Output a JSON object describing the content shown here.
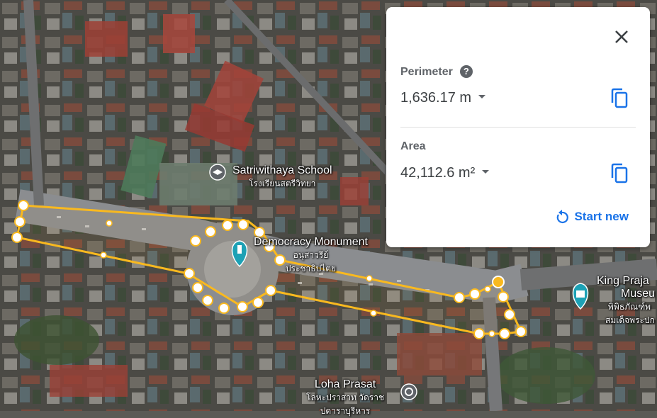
{
  "map": {
    "labels": [
      {
        "main": "Satriwithaya School",
        "sub": "โรงเรียนสตรีวิทยา"
      },
      {
        "main": "Democracy Monument",
        "sub1": "อนุสาวรีย์",
        "sub2": "ประชาธิปไตย"
      },
      {
        "main": "King Praja",
        "main2": "Museu",
        "sub1": "พิพิธภัณฑ์พ",
        "sub2": "สมเด็จพระปก"
      },
      {
        "main": "Loha Prasat",
        "sub1": "โลหะปราสาท วัดราช",
        "sub2": "ปดาราบุรีหาร"
      }
    ],
    "icons": [
      "school-pin-icon",
      "monument-pin-icon",
      "museum-pin-icon",
      "temple-pin-icon"
    ],
    "colors": {
      "measure_line": "#f9b91f",
      "pin": "#1da1b5"
    }
  },
  "panel": {
    "perimeter_label": "Perimeter",
    "help_glyph": "?",
    "perimeter_value": "1,636.17 m",
    "area_label": "Area",
    "area_value": "42,112.6 m²",
    "start_new_label": "Start new",
    "icons": [
      "close-icon",
      "help-icon",
      "copy-icon",
      "dropdown-caret-icon",
      "restart-icon"
    ],
    "accent_color": "#1a73e8"
  }
}
